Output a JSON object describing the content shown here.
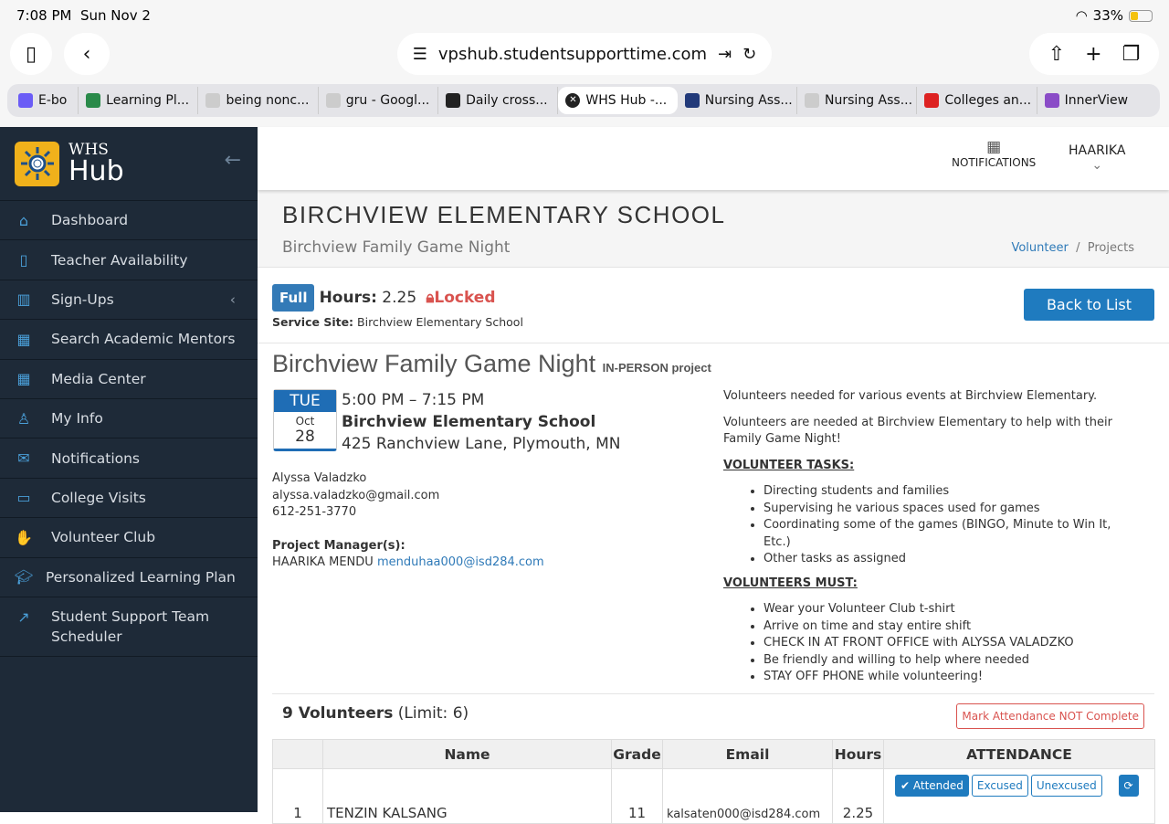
{
  "status": {
    "time": "7:08 PM",
    "date": "Sun Nov 2",
    "battery": "33%",
    "battery_level": 0.33
  },
  "browser": {
    "url": "vpshub.studentsupporttime.com",
    "tabs": [
      {
        "label": "E-bo"
      },
      {
        "label": "Learning Pl..."
      },
      {
        "label": "being nonc..."
      },
      {
        "label": "gru - Googl..."
      },
      {
        "label": "Daily cross..."
      },
      {
        "label": "WHS Hub -...",
        "active": true
      },
      {
        "label": "Nursing Ass..."
      },
      {
        "label": "Nursing Ass..."
      },
      {
        "label": "Colleges an..."
      },
      {
        "label": "InnerView"
      }
    ]
  },
  "logo": {
    "top": "WHS",
    "bottom": "Hub"
  },
  "sidebar": {
    "items": [
      {
        "label": "Dashboard",
        "icon": "home-icon"
      },
      {
        "label": "Teacher Availability",
        "icon": "book-icon"
      },
      {
        "label": "Sign-Ups",
        "icon": "map-icon"
      },
      {
        "label": "Search Academic Mentors",
        "icon": "calendar-icon"
      },
      {
        "label": "Media Center",
        "icon": "calendar-icon"
      },
      {
        "label": "My Info",
        "icon": "user-icon"
      },
      {
        "label": "Notifications",
        "icon": "envelope-icon"
      },
      {
        "label": "College Visits",
        "icon": "briefcase-icon"
      },
      {
        "label": "Volunteer Club",
        "icon": "hand-icon"
      },
      {
        "label": "Personalized Learning Plan",
        "icon": "graduation-cap-icon"
      },
      {
        "label": "Student Support Team Scheduler",
        "icon": "external-link-icon"
      }
    ]
  },
  "header": {
    "notifications": "NOTIFICATIONS",
    "user": "HAARIKA"
  },
  "page": {
    "school": "BIRCHVIEW ELEMENTARY SCHOOL",
    "subtitle": "Birchview Family Game Night",
    "breadcrumb": [
      "Volunteer",
      "Projects"
    ]
  },
  "project": {
    "badge": "Full",
    "hours_label": "Hours:",
    "hours": "2.25",
    "locked": "Locked",
    "site_label": "Service Site:",
    "site": "Birchview Elementary School",
    "back": "Back to List",
    "title": "Birchview Family Game Night",
    "type": "IN-PERSON project",
    "cal": {
      "dow": "TUE",
      "month": "Oct",
      "day": "28"
    },
    "time": "5:00 PM – 7:15 PM",
    "location": "Birchview Elementary School",
    "address": "425 Ranchview Lane, Plymouth, MN",
    "contact": {
      "name": "Alyssa Valadzko",
      "email": "alyssa.valadzko@gmail.com",
      "phone": "612-251-3770"
    },
    "pm_label": "Project Manager(s):",
    "pm_name": "HAARIKA MENDU",
    "pm_email": "menduhaa000@isd284.com",
    "desc1": "Volunteers needed for various events at Birchview Elementary.",
    "desc2": "Volunteers are needed at Birchview Elementary to help with their Family Game Night!",
    "tasks_h": "VOLUNTEER TASKS:",
    "tasks": [
      "Directing students and families",
      "Supervising he various spaces used for games",
      "Coordinating some of the games (BINGO, Minute to Win It, Etc.)",
      "Other tasks as assigned"
    ],
    "must_h": "VOLUNTEERS MUST:",
    "must": [
      "Wear your Volunteer Club t-shirt",
      "Arrive on time and stay entire shift",
      "CHECK IN AT FRONT OFFICE with ALYSSA VALADZKO",
      "Be friendly and willing to help where needed",
      "STAY OFF PHONE while volunteering!"
    ]
  },
  "volunteers": {
    "count": "9 Volunteers",
    "limit": "(Limit: 6)",
    "mark": "Mark Attendance NOT Complete",
    "columns": [
      "",
      "Name",
      "Grade",
      "Email",
      "Hours",
      "ATTENDANCE"
    ],
    "rows": [
      {
        "n": "1",
        "name": "TENZIN KALSANG",
        "grade": "11",
        "email": "kalsaten000@isd284.com",
        "hours": "2.25"
      }
    ],
    "buttons": {
      "attended": "✔ Attended",
      "excused": "Excused",
      "unexcused": "Unexcused"
    }
  }
}
